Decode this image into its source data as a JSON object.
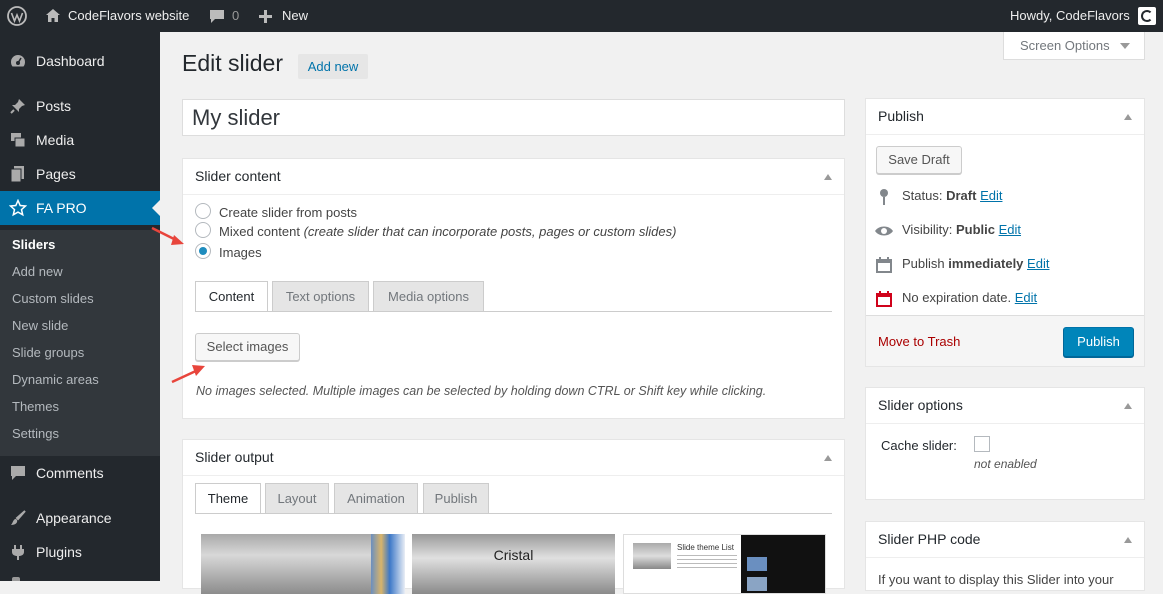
{
  "adminbar": {
    "site_name": "CodeFlavors website",
    "comments_count": "0",
    "new_label": "New",
    "howdy": "Howdy, CodeFlavors"
  },
  "sidebar": {
    "items": [
      {
        "label": "Dashboard",
        "icon": "dashboard-icon"
      },
      {
        "label": "Posts",
        "icon": "pin-icon"
      },
      {
        "label": "Media",
        "icon": "media-icon"
      },
      {
        "label": "Pages",
        "icon": "pages-icon"
      },
      {
        "label": "FA PRO",
        "icon": "star-icon"
      },
      {
        "label": "Comments",
        "icon": "comment-icon"
      },
      {
        "label": "Appearance",
        "icon": "brush-icon"
      },
      {
        "label": "Plugins",
        "icon": "plug-icon"
      }
    ],
    "submenu": [
      "Sliders",
      "Add new",
      "Custom slides",
      "New slide",
      "Slide groups",
      "Dynamic areas",
      "Themes",
      "Settings"
    ]
  },
  "page": {
    "title": "Edit slider",
    "add_new": "Add new",
    "screen_options": "Screen Options",
    "slider_title": "My slider"
  },
  "slider_content": {
    "heading": "Slider content",
    "options": [
      {
        "label": "Create slider from posts",
        "note": "",
        "checked": false
      },
      {
        "label": "Mixed content",
        "note": "(create slider that can incorporate posts, pages or custom slides)",
        "checked": false
      },
      {
        "label": "Images",
        "note": "",
        "checked": true
      }
    ],
    "tabs": [
      "Content",
      "Text options",
      "Media options"
    ],
    "select_images": "Select images",
    "help": "No images selected. Multiple images can be selected by holding down CTRL or Shift key while clicking."
  },
  "slider_output": {
    "heading": "Slider output",
    "tabs": [
      "Theme",
      "Layout",
      "Animation",
      "Publish"
    ],
    "theme_names": [
      "",
      "Cristal",
      "Slide theme List"
    ]
  },
  "publish": {
    "heading": "Publish",
    "save_draft": "Save Draft",
    "status_label": "Status:",
    "status_value": "Draft",
    "visibility_label": "Visibility:",
    "visibility_value": "Public",
    "publish_label": "Publish",
    "publish_value": "immediately",
    "expiration": "No expiration date.",
    "edit": "Edit",
    "move_to_trash": "Move to Trash",
    "publish_button": "Publish"
  },
  "slider_options": {
    "heading": "Slider options",
    "cache_label": "Cache slider:",
    "cache_state": "not enabled"
  },
  "php_code": {
    "heading": "Slider PHP code",
    "text": "If you want to display this Slider into your"
  },
  "colors": {
    "adminbar": "#23282d",
    "accent": "#0073aa",
    "primary_button": "#0085ba",
    "trash": "#a00",
    "annotation": "#e8453c"
  }
}
